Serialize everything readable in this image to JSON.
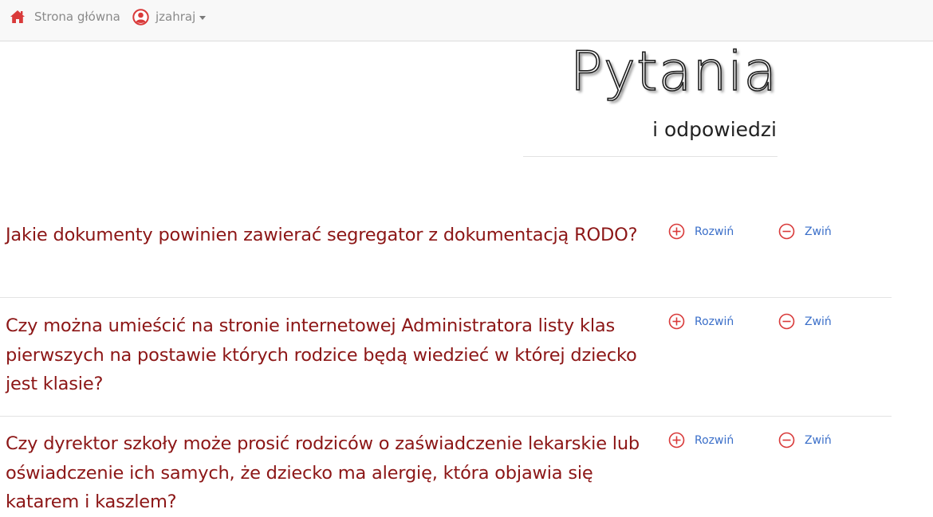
{
  "nav": {
    "home_label": "Strona główna",
    "user_label": "jzahraj"
  },
  "hero": {
    "title": "Pytania",
    "subtitle": "i odpowiedzi"
  },
  "faq": {
    "items": [
      {
        "question": "Jakie dokumenty powinien zawierać segregator z dokumentacją RODO?",
        "expand_label": "Rozwiń",
        "collapse_label": "Zwiń"
      },
      {
        "question": "Czy można umieścić na stronie internetowej Administratora listy klas pierwszych na postawie których rodzice będą wiedzieć w której dziecko jest klasie?",
        "expand_label": "Rozwiń",
        "collapse_label": "Zwiń"
      },
      {
        "question": "Czy dyrektor szkoły może prosić rodziców o zaświadczenie lekarskie lub oświadczenie ich samych, że dziecko ma alergię, która objawia się katarem i kaszlem?",
        "expand_label": "Rozwiń",
        "collapse_label": "Zwiń"
      }
    ]
  },
  "colors": {
    "question": "#8c1616",
    "action_text": "#3b6fc9",
    "icon_red": "#d93a3a",
    "nav_bg": "#f8f8f8"
  },
  "icons": {
    "home": "home-icon",
    "user": "user-circle-icon",
    "expand": "plus-circle-icon",
    "collapse": "minus-circle-icon"
  }
}
